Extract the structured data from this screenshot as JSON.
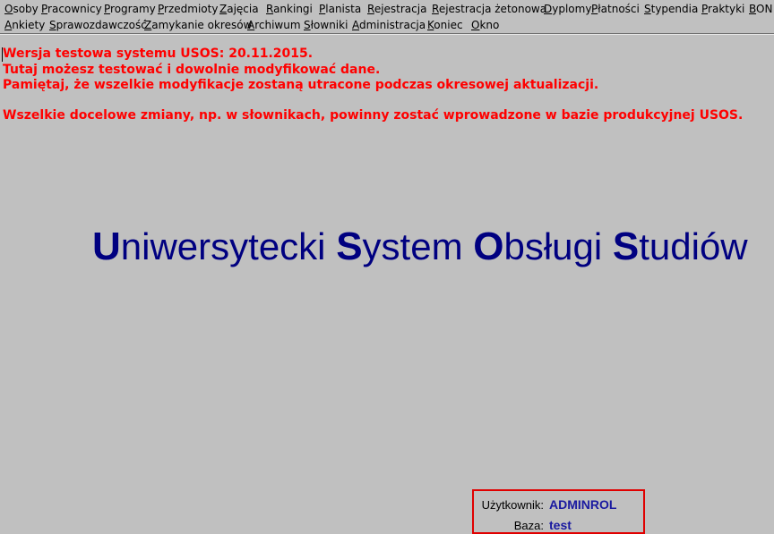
{
  "menu": {
    "row1": [
      {
        "label_ul": "O",
        "label_rest": "soby"
      },
      {
        "label_ul": "P",
        "label_rest": "racownicy"
      },
      {
        "label_ul": "P",
        "label_rest": "rogramy"
      },
      {
        "label_ul": "P",
        "label_rest": "rzedmioty"
      },
      {
        "label_ul": "Z",
        "label_rest": "ajęcia"
      },
      {
        "label_ul": "R",
        "label_rest": "ankingi"
      },
      {
        "label_ul": "P",
        "label_rest": "lanista"
      },
      {
        "label_ul": "R",
        "label_rest": "ejestracja"
      },
      {
        "label_ul": "R",
        "label_rest": "ejestracja żetonowa"
      },
      {
        "label_ul": "D",
        "label_rest": "yplomy"
      },
      {
        "label_ul": "P",
        "label_rest": "łatności"
      },
      {
        "label_ul": "S",
        "label_rest": "typendia"
      },
      {
        "label_ul": "P",
        "label_rest": "raktyki"
      },
      {
        "label_ul": "B",
        "label_rest": "ON"
      }
    ],
    "row2": [
      {
        "label_ul": "A",
        "label_rest": "nkiety"
      },
      {
        "label_ul": "S",
        "label_rest": "prawozdawczość"
      },
      {
        "label_ul": "Z",
        "label_rest": "amykanie okresów"
      },
      {
        "label_ul": "A",
        "label_rest": "rchiwum"
      },
      {
        "label_ul": "S",
        "label_rest": "łowniki"
      },
      {
        "label_ul": "A",
        "label_rest": "dministracja"
      },
      {
        "label_ul": "K",
        "label_rest": "oniec"
      },
      {
        "label_ul": "O",
        "label_rest": "kno"
      }
    ]
  },
  "notice": {
    "line1": "Wersja testowa systemu USOS: 20.11.2015.",
    "line2": "Tutaj możesz testować i dowolnie modyfikować dane.",
    "line3": "Pamiętaj, że wszelkie modyfikacje zostaną utracone podczas okresowej aktualizacji.",
    "line4": "Wszelkie docelowe zmiany, np. w słownikach, powinny zostać wprowadzone w bazie produkcyjnej USOS."
  },
  "system_title": {
    "w1_initial": "U",
    "w1_rest": "niwersytecki ",
    "w2_initial": "S",
    "w2_rest": "ystem ",
    "w3_initial": "O",
    "w3_rest": "bsługi ",
    "w4_initial": "S",
    "w4_rest": "tudiów"
  },
  "status": {
    "user_label": "Użytkownik:",
    "user_value": "ADMINROL",
    "db_label": "Baza:",
    "db_value": "test"
  },
  "colors": {
    "background": "#c0c0c0",
    "notice_text": "#ff0000",
    "title_text": "#000080",
    "status_value": "#1a1aa0",
    "status_border": "#e00000"
  }
}
